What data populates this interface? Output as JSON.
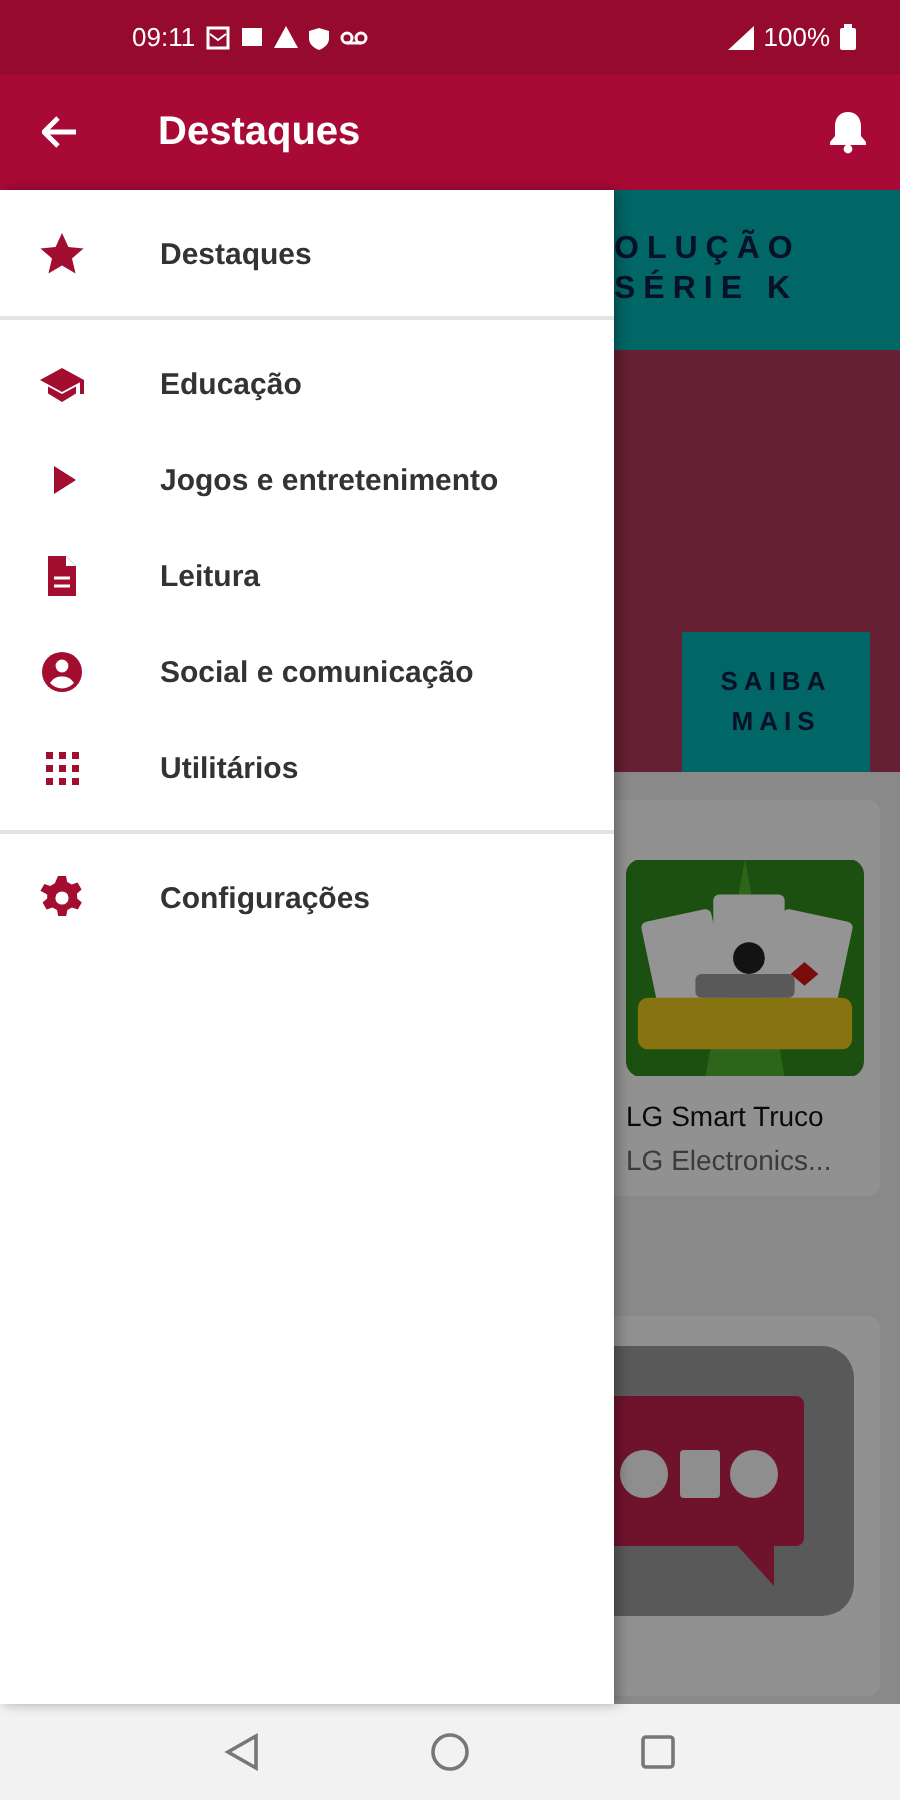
{
  "status_bar": {
    "time": "09:11",
    "battery": "100%"
  },
  "app_bar": {
    "title": "Destaques"
  },
  "drawer": {
    "sections": [
      [
        {
          "label": "Destaques"
        }
      ],
      [
        {
          "label": "Educação"
        },
        {
          "label": "Jogos e entretenimento"
        },
        {
          "label": "Leitura"
        },
        {
          "label": "Social e comunicação"
        },
        {
          "label": "Utilitários"
        }
      ],
      [
        {
          "label": "Configurações"
        }
      ]
    ]
  },
  "banner": {
    "title_lines": [
      "OLUÇÃO",
      "SÉRIE K"
    ],
    "button": "SAIBA MAIS"
  },
  "cards": [
    {
      "kind": "app",
      "name": "LG Smart Truco",
      "developer": "LG Electronics..."
    },
    {
      "kind": "picture"
    }
  ]
}
